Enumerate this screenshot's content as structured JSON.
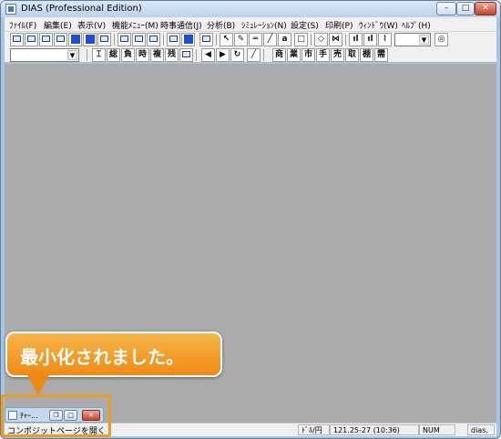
{
  "window": {
    "title": "DIAS (Professional Edition)",
    "minimize": "–",
    "maximize": "□",
    "close": "✕"
  },
  "menu": [
    "ﾌｧｲﾙ(F)",
    "編集(E)",
    "表示(V)",
    "機能ﾒﾆｭｰ(M)",
    "時事通信(J)",
    "分析(B)",
    "ｼﾐｭﾚｰｼｮﾝ(N)",
    "設定(S)",
    "印刷(P)",
    "ｳｨﾝﾄﾞｳ(W)",
    "ﾍﾙﾌﾟ(H)"
  ],
  "toolbar2_labels": {
    "total": "総",
    "negative": "負",
    "time": "時",
    "composite": "複",
    "list": "残",
    "arrow_left": "◀",
    "arrow_right": "▶",
    "refresh": "↻",
    "commerce": "商",
    "business": "業",
    "market": "市",
    "hand": "手",
    "sell": "売",
    "trade": "取",
    "shelf": "棚",
    "bond": "需"
  },
  "minimized_window": {
    "title": "ﾁｬｰ..."
  },
  "callout": {
    "text": "最小化されました。"
  },
  "statusbar": {
    "message": "コンポジットページを開く",
    "currency": "ﾄﾞﾙ/円",
    "rate": "121.25-27 (10:36)",
    "num": "NUM",
    "brand": "dias."
  }
}
